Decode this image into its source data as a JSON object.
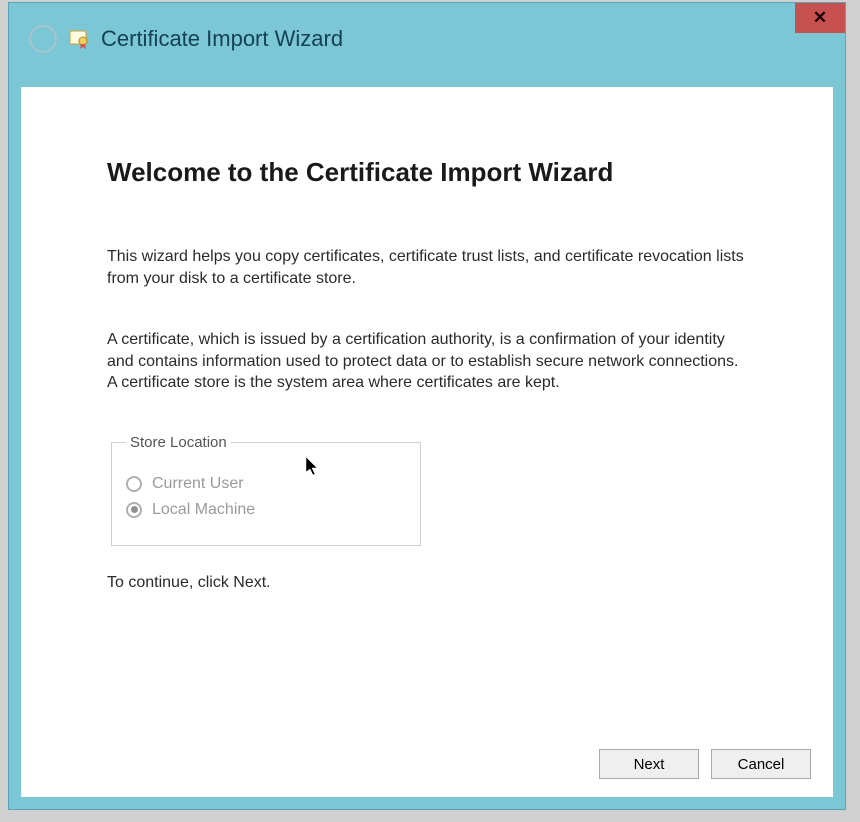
{
  "window": {
    "title": "Certificate Import Wizard",
    "close_symbol": "✕"
  },
  "heading": "Welcome to the Certificate Import Wizard",
  "paragraph1": "This wizard helps you copy certificates, certificate trust lists, and certificate revocation lists from your disk to a certificate store.",
  "paragraph2": "A certificate, which is issued by a certification authority, is a confirmation of your identity and contains information used to protect data or to establish secure network connections. A certificate store is the system area where certificates are kept.",
  "store_location": {
    "legend": "Store Location",
    "option1": "Current User",
    "option2": "Local Machine",
    "selected": "Local Machine",
    "disabled": true
  },
  "continue_text": "To continue, click Next.",
  "buttons": {
    "next": "Next",
    "cancel": "Cancel"
  }
}
